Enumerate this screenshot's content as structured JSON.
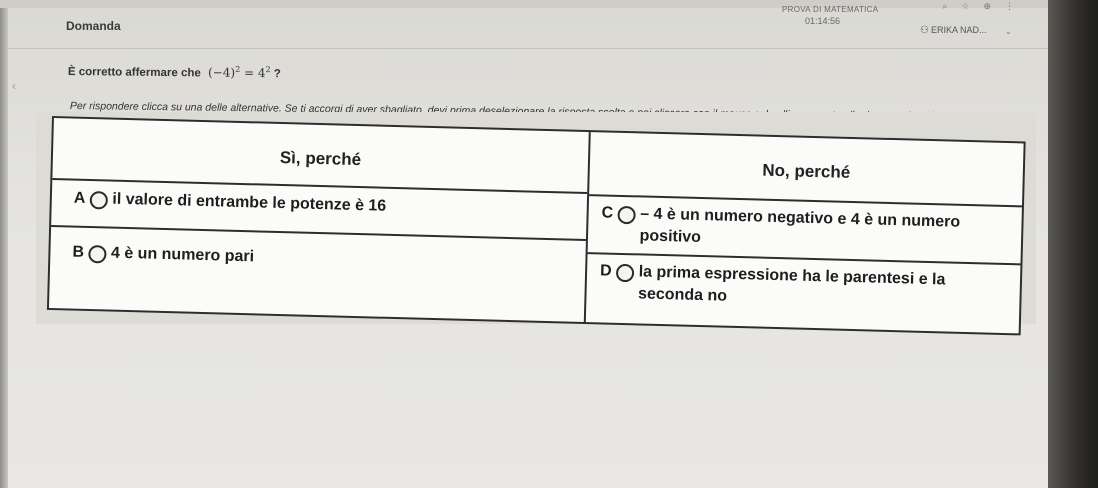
{
  "header": {
    "domanda_label": "Domanda",
    "exam_title": "PROVA DI MATEMATICA",
    "timer": "01:14:56",
    "user_name": "ERIKA NAD..."
  },
  "question": {
    "prefix": "È corretto affermare che",
    "expression_base": "(−4)",
    "exp1": "2",
    "equals": " = 4",
    "exp2": "2",
    "suffix": " ?"
  },
  "instructions": "Per rispondere clicca su una delle alternative. Se ti accorgi di aver sbagliato, devi prima deselezionare la risposta scelta e poi cliccare con il mouse sul pallino accanto alla risposta che ritieni corretta.",
  "table": {
    "col_yes_header": "Sì, perché",
    "col_no_header": "No, perché",
    "options": [
      {
        "letter": "A",
        "text": "il valore di entrambe le potenze è 16"
      },
      {
        "letter": "B",
        "text": "4 è un numero pari"
      },
      {
        "letter": "C",
        "text": "– 4 è un numero negativo e 4 è un numero positivo"
      },
      {
        "letter": "D",
        "text": "la prima espressione ha le parentesi e la seconda no"
      }
    ]
  }
}
